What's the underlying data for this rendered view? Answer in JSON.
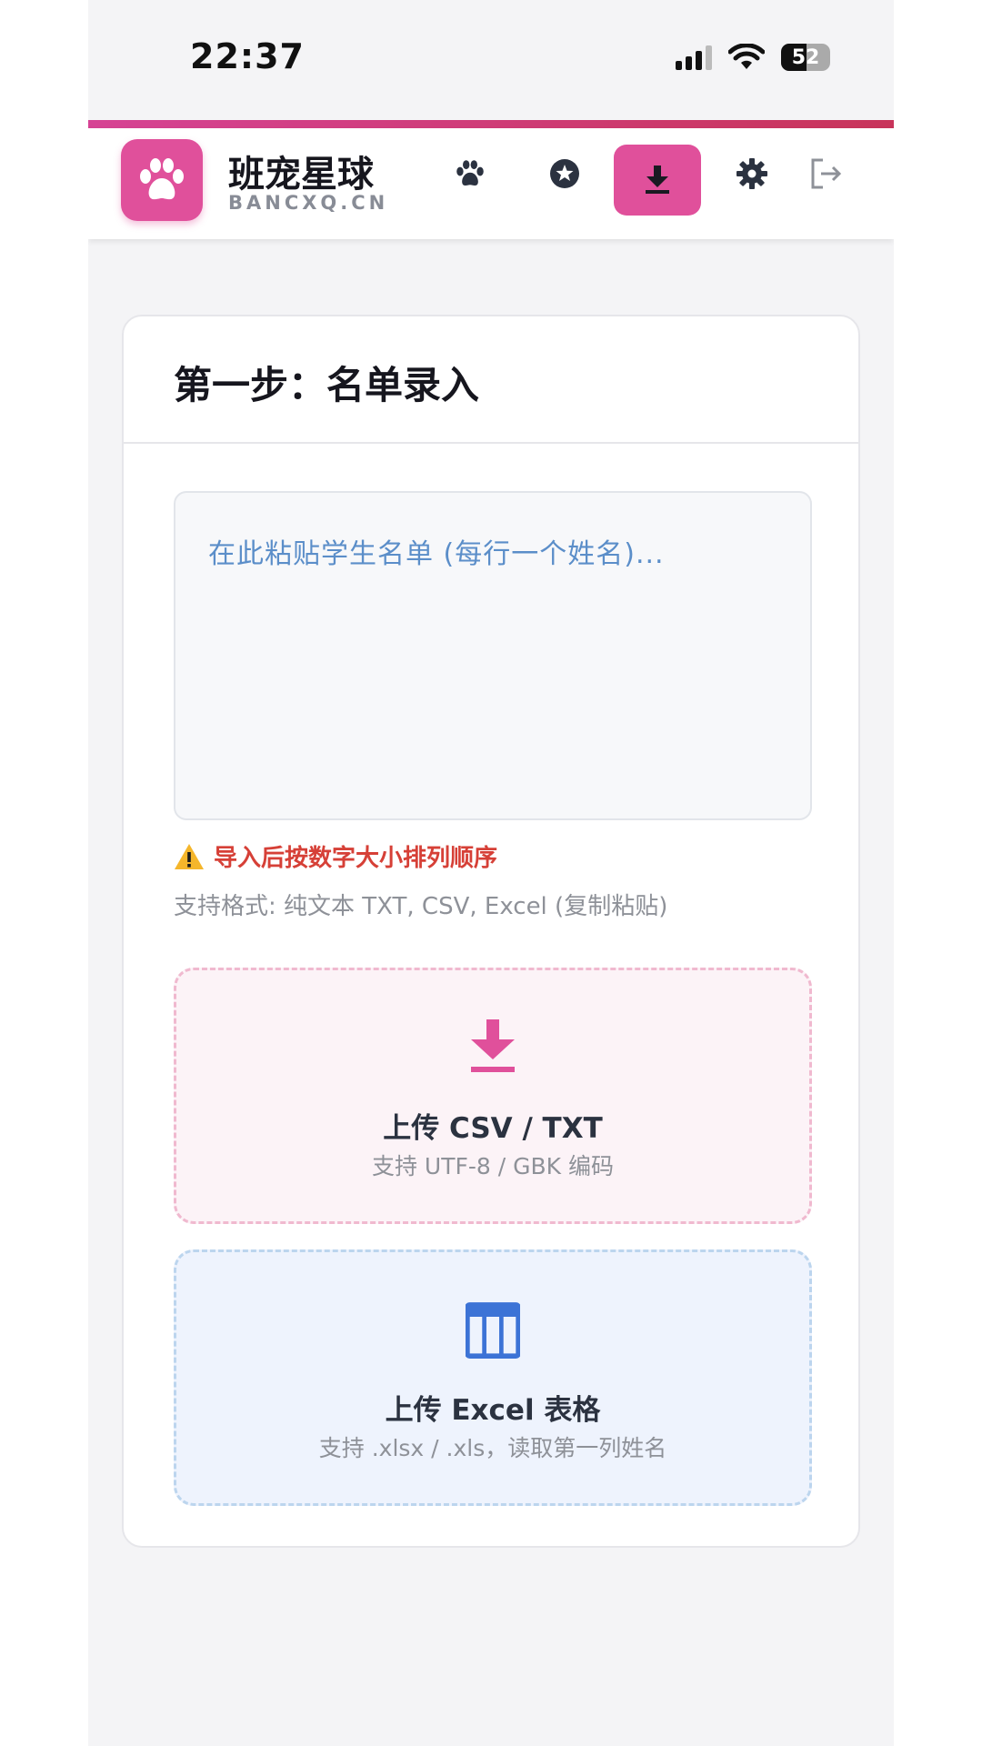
{
  "status_bar": {
    "time": "22:37",
    "battery": "52",
    "battery_level": 0.52
  },
  "header": {
    "brand_name": "班宠星球",
    "brand_domain": "BANCXQ.CN",
    "nav_icons": [
      "paw-icon",
      "star-icon",
      "download-icon",
      "gear-icon",
      "logout-icon"
    ],
    "active_nav": "download-icon"
  },
  "colors": {
    "accent": "#e0509b",
    "warning": "#d64037",
    "excel_blue": "#3c73d6"
  },
  "card": {
    "title": "第一步：名单录入",
    "textarea_placeholder": "在此粘贴学生名单 (每行一个姓名)...",
    "warning_text": "导入后按数字大小排列顺序",
    "formats_text": "支持格式: 纯文本 TXT, CSV, Excel (复制粘贴)",
    "upload_csv": {
      "title": "上传 CSV / TXT",
      "subtitle": "支持 UTF-8 / GBK 编码"
    },
    "upload_excel": {
      "title": "上传 Excel 表格",
      "subtitle": "支持 .xlsx / .xls，读取第一列姓名"
    }
  }
}
